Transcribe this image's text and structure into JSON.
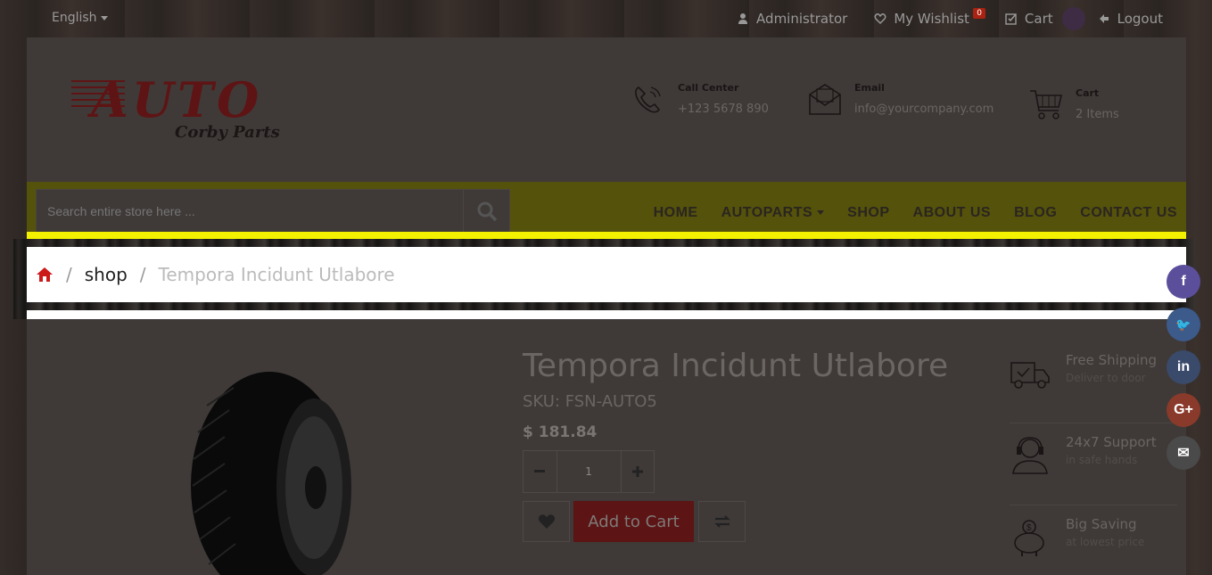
{
  "topbar": {
    "language": "English",
    "links": [
      {
        "label": "Administrator",
        "icon": "user-icon"
      },
      {
        "label": "My Wishlist",
        "icon": "heart-icon",
        "badge": "0"
      },
      {
        "label": "Cart",
        "icon": "checkbox-icon"
      },
      {
        "label": "Logout",
        "icon": "sign-out-icon"
      }
    ]
  },
  "logo": {
    "main": "AUTO",
    "sub": "Corby Parts"
  },
  "header_info": [
    {
      "title": "Call Center",
      "value": "+123 5678 890",
      "icon": "phone-icon"
    },
    {
      "title": "Email",
      "value": "info@yourcompany.com",
      "icon": "envelope-icon"
    },
    {
      "title": "Cart",
      "value": "2 Items",
      "icon": "cart-icon"
    }
  ],
  "search": {
    "placeholder": "Search entire store here ..."
  },
  "nav": [
    "HOME",
    "AUTOPARTS",
    "SHOP",
    "ABOUT US",
    "BLOG",
    "CONTACT US"
  ],
  "breadcrumb": {
    "shop": "shop",
    "current": "Tempora Incidunt Utlabore",
    "sep": "/"
  },
  "product": {
    "title": "Tempora Incidunt Utlabore",
    "sku": "SKU: FSN-AUTO5",
    "price": "$ 181.84",
    "quantity": "1",
    "add_to_cart": "Add to Cart"
  },
  "features": [
    {
      "title": "Free Shipping",
      "subtitle": "Deliver to door",
      "icon": "truck-icon"
    },
    {
      "title": "24x7 Support",
      "subtitle": "in safe hands",
      "icon": "headset-icon"
    },
    {
      "title": "Big Saving",
      "subtitle": "at lowest price",
      "icon": "piggy-bank-icon"
    }
  ],
  "social": [
    {
      "name": "facebook-icon",
      "glyph": "f",
      "color": "#5b4f9c"
    },
    {
      "name": "twitter-icon",
      "glyph": "🐦",
      "color": "#3c5a8a"
    },
    {
      "name": "linkedin-icon",
      "glyph": "in",
      "color": "#3a4a6a"
    },
    {
      "name": "google-plus-icon",
      "glyph": "G+",
      "color": "#8a3a2a"
    },
    {
      "name": "mail-icon",
      "glyph": "✉",
      "color": "#4a4a4a"
    }
  ],
  "colors": {
    "accent_red": "#cc1a1a",
    "nav_yellow": "#f3f000",
    "overlay_bg": "#3f3a38"
  }
}
